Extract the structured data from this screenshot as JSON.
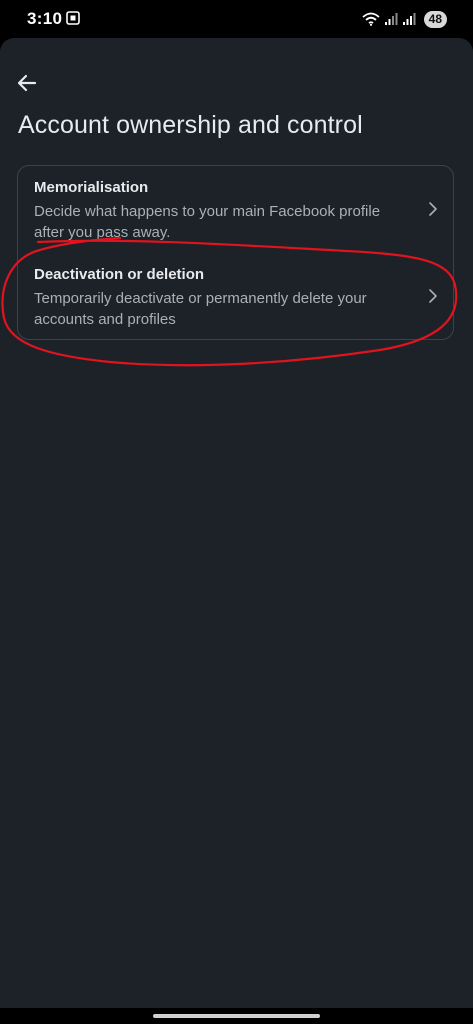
{
  "status_bar": {
    "time": "3:10",
    "battery": "48"
  },
  "header": {
    "title": "Account ownership and control"
  },
  "options": [
    {
      "title": "Memorialisation",
      "description": "Decide what happens to your main Facebook profile after you pass away."
    },
    {
      "title": "Deactivation or deletion",
      "description": "Temporarily deactivate or permanently delete your accounts and profiles"
    }
  ],
  "colors": {
    "background": "#1c2228",
    "annotation": "#e0141e"
  },
  "icons": {
    "back": "arrow-left-icon",
    "chevron": "chevron-right-icon"
  }
}
